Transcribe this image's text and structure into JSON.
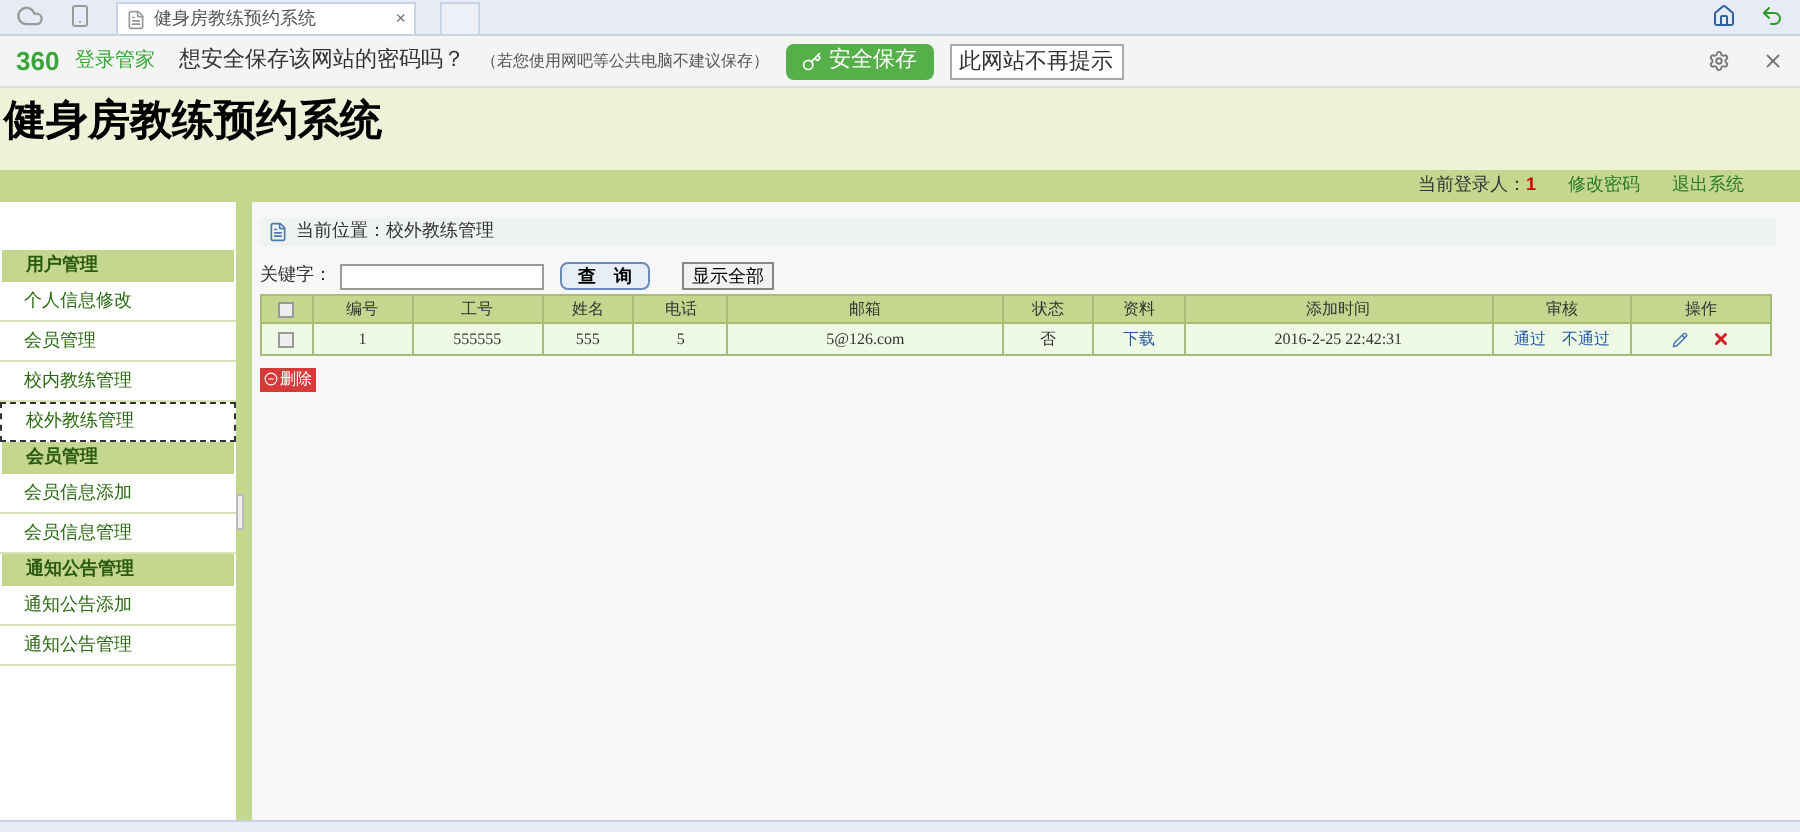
{
  "browser": {
    "tab_title": "健身房教练预约系统",
    "close": "×"
  },
  "password_bar": {
    "brand": "360",
    "brand_name": "登录管家",
    "question": "想安全保存该网站的密码吗？",
    "hint": "（若您使用网吧等公共电脑不建议保存）",
    "save_button": "安全保存",
    "dismiss_button": "此网站不再提示"
  },
  "header": {
    "title": "健身房教练预约系统",
    "login_label": "当前登录人：",
    "login_user": "1",
    "links": [
      "修改密码",
      "退出系统"
    ]
  },
  "sidebar": {
    "groups": [
      {
        "title": "用户管理",
        "items": [
          {
            "label": "个人信息修改",
            "selected": false
          },
          {
            "label": "会员管理",
            "selected": false
          },
          {
            "label": "校内教练管理",
            "selected": false
          },
          {
            "label": "校外教练管理",
            "selected": true
          }
        ]
      },
      {
        "title": "会员管理",
        "items": [
          {
            "label": "会员信息添加",
            "selected": false
          },
          {
            "label": "会员信息管理",
            "selected": false
          }
        ]
      },
      {
        "title": "通知公告管理",
        "items": [
          {
            "label": "通知公告添加",
            "selected": false
          },
          {
            "label": "通知公告管理",
            "selected": false
          }
        ]
      }
    ]
  },
  "breadcrumb": "当前位置：校外教练管理",
  "search": {
    "label": "关键字：",
    "query_button": "查　询",
    "show_all_button": "显示全部"
  },
  "table": {
    "select_all_checked": false,
    "columns": [
      "编号",
      "工号",
      "姓名",
      "电话",
      "邮箱",
      "状态",
      "资料",
      "添加时间",
      "审核",
      "操作"
    ],
    "rows": [
      {
        "checked": false,
        "cells": [
          "1",
          "555555",
          "555",
          "5",
          "5@126.com",
          "否",
          "下载",
          "2016-2-25 22:42:31"
        ],
        "review": [
          "通过",
          "不通过"
        ]
      }
    ]
  },
  "delete_button": "删除"
}
